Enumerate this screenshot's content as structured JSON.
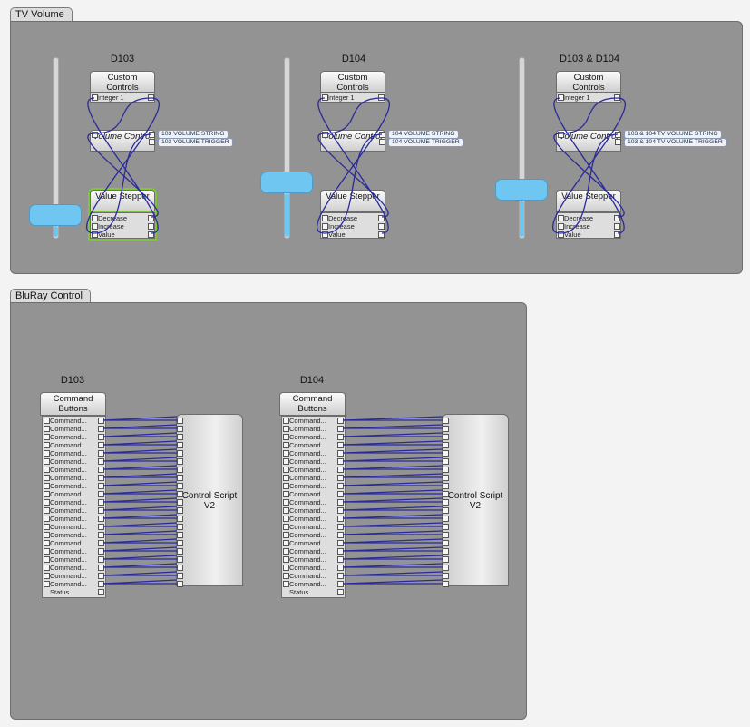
{
  "tv_volume": {
    "tab_label": "TV Volume",
    "groups": [
      {
        "title": "D103",
        "custom_controls": "Custom Controls",
        "integer_port": "Integer 1",
        "volume_control": "Volume Control",
        "value_stepper": "Value Stepper",
        "stepper_ports": [
          "Decrease",
          "Increase",
          "Value"
        ],
        "volume_string": "103 VOLUME STRING",
        "volume_trigger": "103 VOLUME TRIGGER",
        "slider_level": 0.06,
        "stepper_selected": true
      },
      {
        "title": "D104",
        "custom_controls": "Custom Controls",
        "integer_port": "Integer 1",
        "volume_control": "Volume Control",
        "value_stepper": "Value Stepper",
        "stepper_ports": [
          "Decrease",
          "Increase",
          "Value"
        ],
        "volume_string": "104 VOLUME STRING",
        "volume_trigger": "104 VOLUME TRIGGER",
        "slider_level": 0.24,
        "stepper_selected": false
      },
      {
        "title": "D103 & D104",
        "custom_controls": "Custom Controls",
        "integer_port": "Integer 1",
        "volume_control": "Volume Control",
        "value_stepper": "Value Stepper",
        "stepper_ports": [
          "Decrease",
          "Increase",
          "Value"
        ],
        "volume_string": "103 & 104 TV VOLUME STRING",
        "volume_trigger": "103 & 104 TV VOLUME TRIGGER",
        "slider_level": 0.2,
        "stepper_selected": false
      }
    ]
  },
  "bluray_control": {
    "tab_label": "BluRay Control",
    "groups": [
      {
        "title": "D103",
        "command_buttons": "Command Buttons",
        "control_script": "Control Script V2",
        "port_label": "Command...",
        "port_count": 21,
        "status_label": "Status"
      },
      {
        "title": "D104",
        "command_buttons": "Command Buttons",
        "control_script": "Control Script V2",
        "port_label": "Command...",
        "port_count": 21,
        "status_label": "Status"
      }
    ]
  },
  "colors": {
    "wire": "#2a2a9a",
    "slider_fill": "#6ec6f1",
    "panel": "#939393",
    "selected_outline": "#7cc63a"
  }
}
